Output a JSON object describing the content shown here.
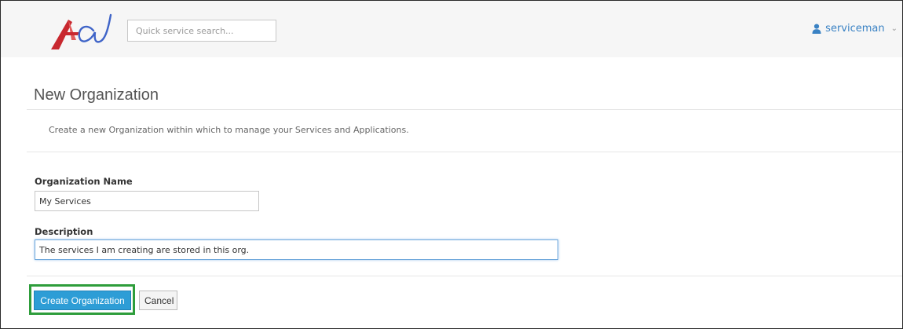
{
  "header": {
    "search_placeholder": "Quick service search...",
    "user": {
      "name": "serviceman",
      "icon": "user-icon",
      "chevron_icon": "chevron-down-icon"
    },
    "logo_icon": "brand-logo",
    "colors": {
      "link": "#3a82c4",
      "logo_red": "#c8282f",
      "logo_blue": "#3f64c8"
    }
  },
  "page": {
    "title": "New Organization",
    "subtitle": "Create a new Organization within which to manage your Services and Applications."
  },
  "form": {
    "name_label": "Organization Name",
    "name_value": "My Services",
    "description_label": "Description",
    "description_value": "The services I am creating are stored in this org."
  },
  "actions": {
    "create_label": "Create Organization",
    "cancel_label": "Cancel",
    "primary_color": "#2d9dd6",
    "highlight_color": "#2e9d3b"
  }
}
